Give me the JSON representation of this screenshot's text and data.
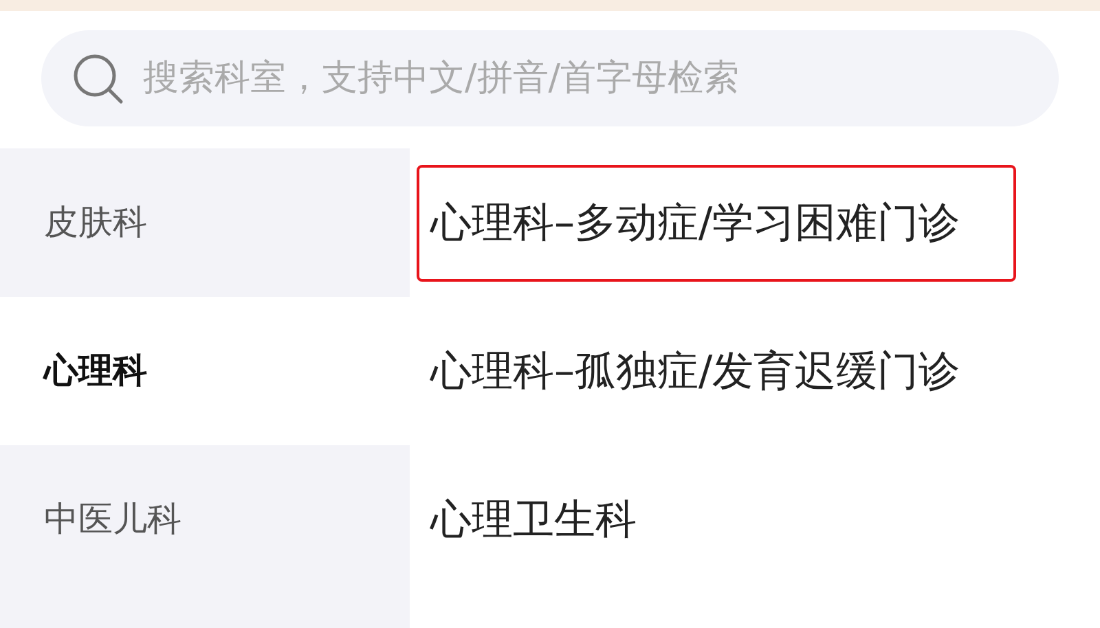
{
  "search": {
    "placeholder": "搜索科室，支持中文/拼音/首字母检索"
  },
  "categories": [
    {
      "label": "皮肤科",
      "selected": false
    },
    {
      "label": "心理科",
      "selected": true
    },
    {
      "label": "中医儿科",
      "selected": false
    }
  ],
  "departments": [
    {
      "label": "心理科–多动症/学习困难门诊",
      "highlighted": true
    },
    {
      "label": "心理科–孤独症/发育迟缓门诊",
      "highlighted": false
    },
    {
      "label": "心理卫生科",
      "highlighted": false
    }
  ]
}
